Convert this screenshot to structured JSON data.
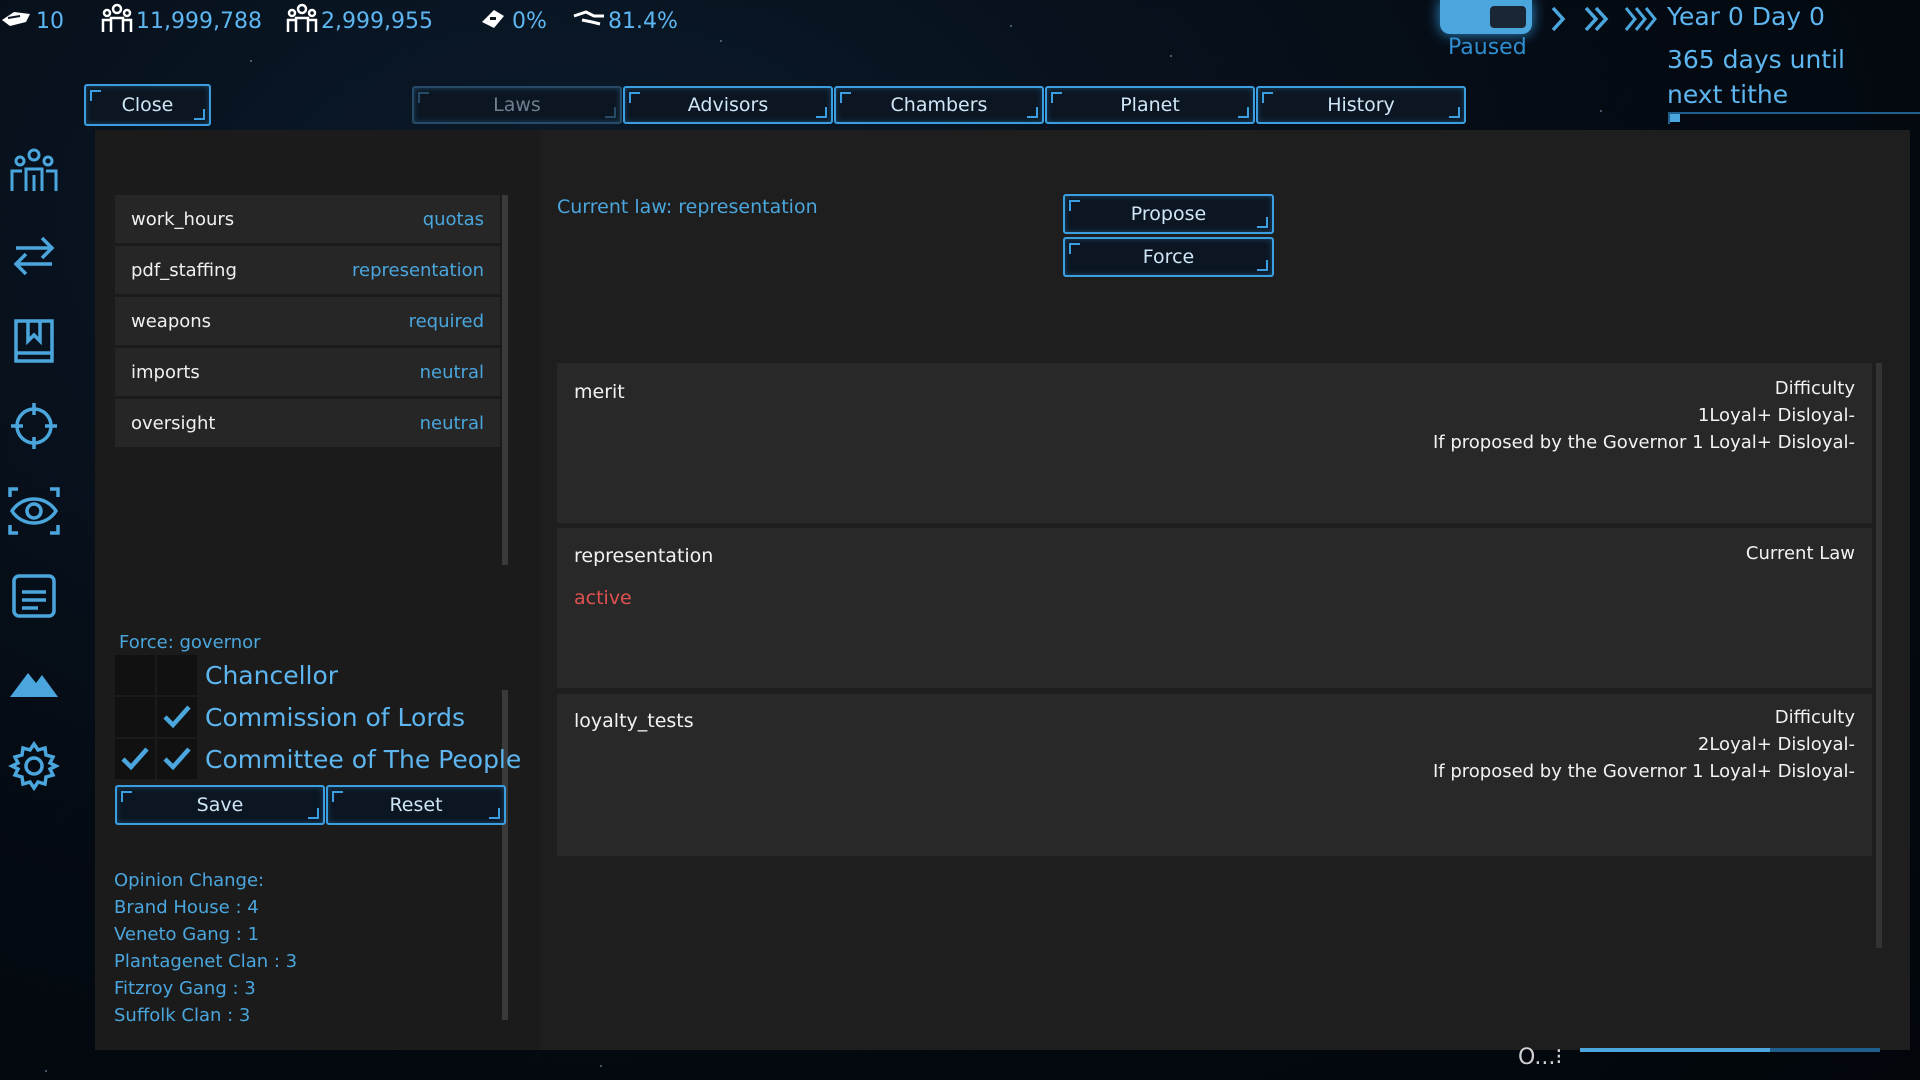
{
  "topbar": {
    "stats": [
      {
        "icon": "requisition-icon",
        "value": "10"
      },
      {
        "icon": "population-icon",
        "value": "11,999,788"
      },
      {
        "icon": "workforce-icon",
        "value": "2,999,955"
      },
      {
        "icon": "crime-icon",
        "value": "0%"
      },
      {
        "icon": "loyalty-icon",
        "value": "81.4%"
      }
    ],
    "paused_label": "Paused",
    "date": "Year 0 Day 0",
    "tithe_text": "365 days until next tithe",
    "tithe_progress": 0.04
  },
  "header": {
    "close": "Close",
    "tabs": [
      {
        "label": "Laws",
        "active": true
      },
      {
        "label": "Advisors"
      },
      {
        "label": "Chambers"
      },
      {
        "label": "Planet"
      },
      {
        "label": "History"
      }
    ]
  },
  "sidebar": {
    "icons": [
      "people-icon",
      "trade-icon",
      "journal-icon",
      "target-icon",
      "eye-icon",
      "document-icon",
      "mountain-icon",
      "gear-icon"
    ]
  },
  "laws": [
    {
      "name": "work_hours",
      "value": "quotas"
    },
    {
      "name": "pdf_staffing",
      "value": "representation"
    },
    {
      "name": "weapons",
      "value": "required"
    },
    {
      "name": "imports",
      "value": "neutral"
    },
    {
      "name": "oversight",
      "value": "neutral"
    }
  ],
  "force": {
    "label": "Force: governor",
    "chambers": [
      {
        "name": "Chancellor",
        "check1": false,
        "check2": false
      },
      {
        "name": "Commission of Lords",
        "check1": false,
        "check2": true
      },
      {
        "name": "Committee of The People",
        "check1": true,
        "check2": true
      }
    ],
    "save": "Save",
    "reset": "Reset"
  },
  "opinion": {
    "title": "Opinion Change:",
    "lines": [
      "Brand House : 4",
      "Veneto Gang : 1",
      "Plantagenet Clan : 3",
      "Fitzroy Gang : 3",
      "Suffolk Clan : 3"
    ]
  },
  "detail": {
    "current_law": "Current law: representation",
    "propose": "Propose",
    "force": "Force",
    "options": [
      {
        "title": "merit",
        "right": [
          "Difficulty",
          "1Loyal+ Disloyal-",
          "If proposed by the Governor 1 Loyal+ Disloyal-"
        ]
      },
      {
        "title": "representation",
        "status": "active",
        "right": [
          "Current Law"
        ]
      },
      {
        "title": "loyalty_tests",
        "right": [
          "Difficulty",
          "2Loyal+ Disloyal-",
          "If proposed by the Governor 1 Loyal+ Disloyal-"
        ]
      }
    ]
  },
  "footer": {
    "text": "O...⁝"
  },
  "colors": {
    "accent": "#4aa6dd",
    "active_red": "#e0514f",
    "panel": "#1e1e1e"
  }
}
